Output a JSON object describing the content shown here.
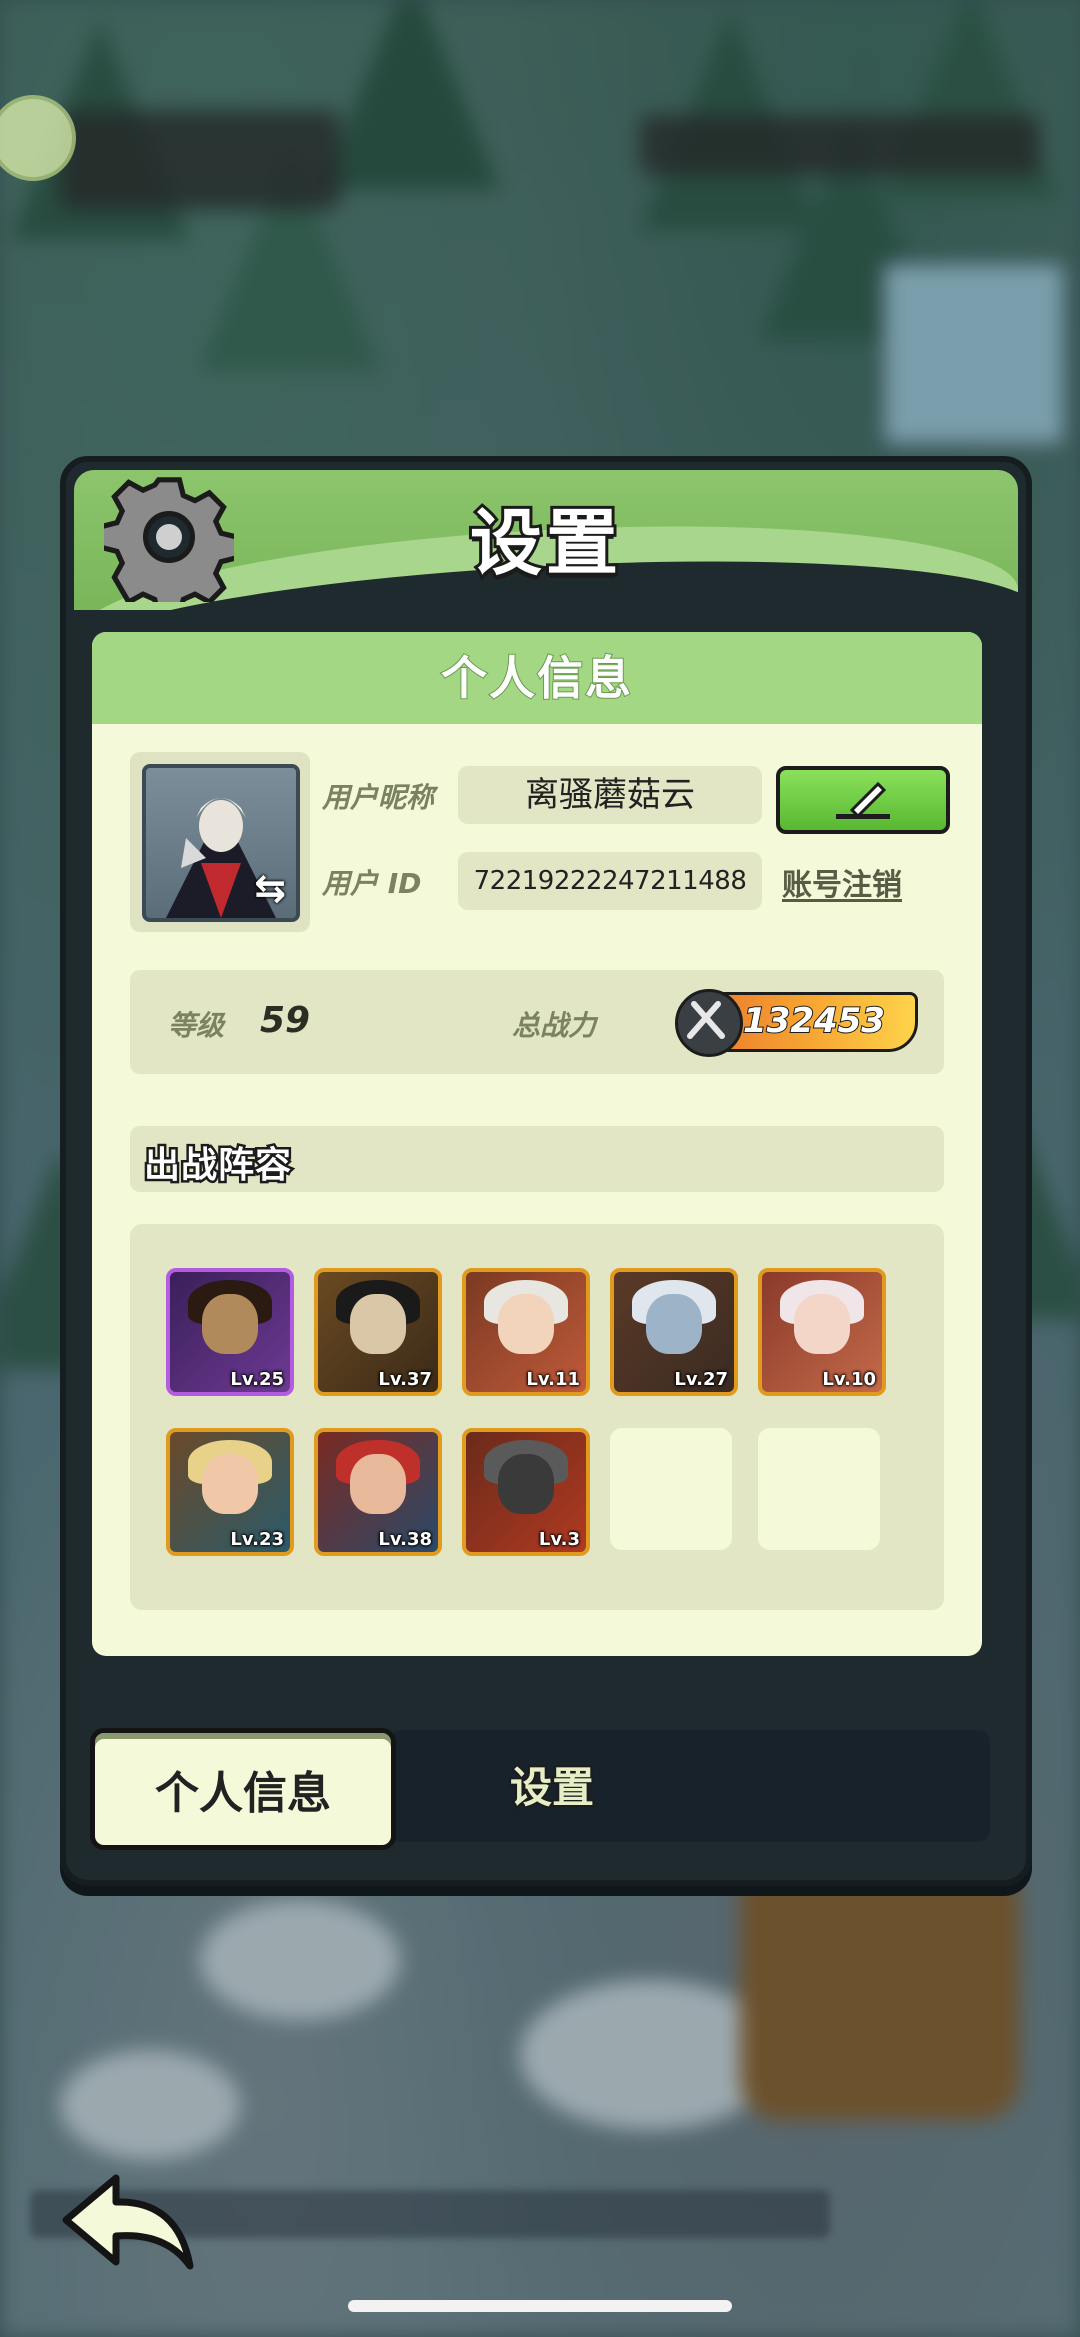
{
  "panel": {
    "title": "设置"
  },
  "card": {
    "header": "个人信息"
  },
  "profile": {
    "nickname_label": "用户昵称",
    "nickname": "离骚蘑菇云",
    "id_label": "用户  ID",
    "user_id": "72219222247211488",
    "logout_label": "账号注销"
  },
  "stats": {
    "level_label": "等级",
    "level": "59",
    "power_label": "总战力",
    "power": "132453"
  },
  "lineup": {
    "title": "出战阵容",
    "heroes": [
      {
        "lv": "Lv.25",
        "frame": "purple"
      },
      {
        "lv": "Lv.37",
        "frame": "gold"
      },
      {
        "lv": "Lv.11",
        "frame": "gold"
      },
      {
        "lv": "Lv.27",
        "frame": "gold"
      },
      {
        "lv": "Lv.10",
        "frame": "gold"
      },
      {
        "lv": "Lv.23",
        "frame": "gold"
      },
      {
        "lv": "Lv.38",
        "frame": "gold"
      },
      {
        "lv": "Lv.3",
        "frame": "gold"
      }
    ],
    "empty_slots": 2
  },
  "tabs": [
    {
      "label": "个人信息",
      "active": true
    },
    {
      "label": "设置",
      "active": false
    }
  ],
  "icons": [
    "gear-icon",
    "swap-icon",
    "edit-icon",
    "sword-icon",
    "back-arrow-icon"
  ],
  "colors": {
    "accent_green": "#79b65a",
    "card_bg": "#f4f9d9",
    "hero_frame": "#e09a1e",
    "hero_frame_rare": "#b45ce0"
  }
}
